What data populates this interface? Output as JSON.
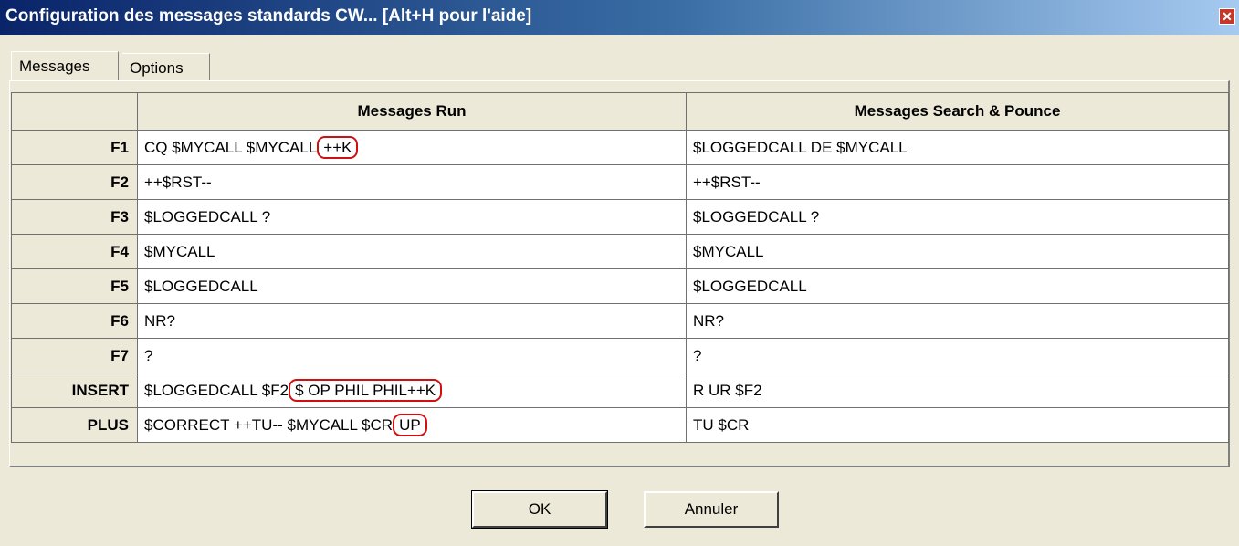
{
  "window": {
    "title": "Configuration des messages standards CW... [Alt+H pour l'aide]",
    "close_label": "✕"
  },
  "tabs": [
    {
      "label": "Messages",
      "active": true
    },
    {
      "label": "Options",
      "active": false
    }
  ],
  "table": {
    "headers": [
      "Messages Run",
      "Messages Search & Pounce"
    ],
    "rows": [
      {
        "key": "F1",
        "run_pre": "CQ $MYCALL $MYCALL",
        "run_hl": "++K",
        "run_post": "",
        "sp": "$LOGGEDCALL DE $MYCALL"
      },
      {
        "key": "F2",
        "run_pre": "++$RST--",
        "run_hl": "",
        "run_post": "",
        "sp": "++$RST--"
      },
      {
        "key": "F3",
        "run_pre": "$LOGGEDCALL ?",
        "run_hl": "",
        "run_post": "",
        "sp": "$LOGGEDCALL ?"
      },
      {
        "key": "F4",
        "run_pre": "$MYCALL",
        "run_hl": "",
        "run_post": "",
        "sp": "$MYCALL"
      },
      {
        "key": "F5",
        "run_pre": "$LOGGEDCALL",
        "run_hl": "",
        "run_post": "",
        "sp": "$LOGGEDCALL"
      },
      {
        "key": "F6",
        "run_pre": "NR?",
        "run_hl": "",
        "run_post": "",
        "sp": "NR?"
      },
      {
        "key": "F7",
        "run_pre": "?",
        "run_hl": "",
        "run_post": "",
        "sp": "?"
      },
      {
        "key": "INSERT",
        "run_pre": "$LOGGEDCALL $F2",
        "run_hl": "$ OP PHIL PHIL++K",
        "run_post": "",
        "sp": "R UR $F2"
      },
      {
        "key": "PLUS",
        "run_pre": "$CORRECT ++TU-- $MYCALL $CR",
        "run_hl": "UP",
        "run_post": "",
        "sp": "TU $CR"
      }
    ]
  },
  "buttons": {
    "ok_label": "OK",
    "cancel_label": "Annuler"
  },
  "colors": {
    "highlight": "#d01010",
    "titlebar": "#0a246a",
    "face": "#ece9d8"
  }
}
